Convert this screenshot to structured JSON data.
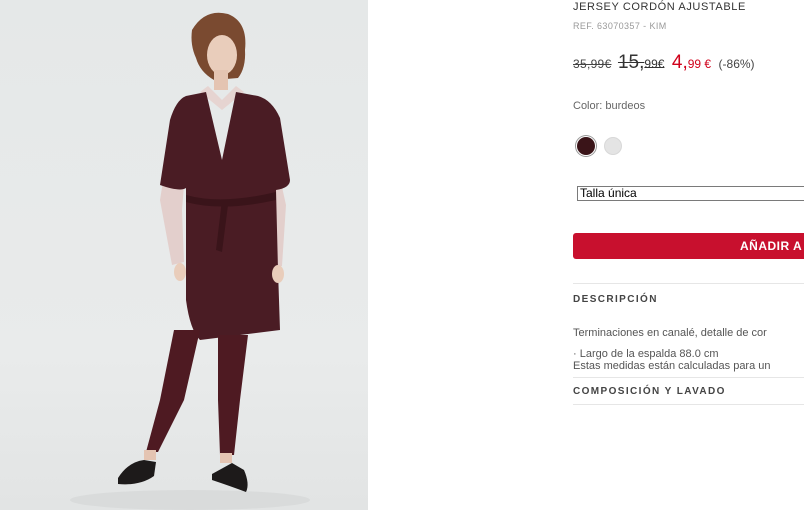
{
  "product": {
    "title": "JERSEY CORDÓN AJUSTABLE",
    "ref": "REF. 63070357 - KIM",
    "price_original": "35,99€",
    "price_previous_main": "15,",
    "price_previous_cents": "99€",
    "price_sale_main": "4,",
    "price_sale_cents": "99 €",
    "discount": "(-86%)",
    "color_label": "Color: burdeos",
    "colors": [
      {
        "name": "burdeos",
        "hex": "#3a1418",
        "selected": true
      },
      {
        "name": "blanco",
        "hex": "#e4e4e4",
        "selected": false
      }
    ],
    "size_selected": "Talla única",
    "add_button_label": "AÑADIR A",
    "description_heading": "DESCRIPCIÓN",
    "description_text": "Terminaciones en canalé, detalle de cor",
    "measure_line1": "· Largo de la espalda 88.0 cm",
    "measure_line2": "Estas medidas están calculadas para un",
    "composition_heading": "COMPOSICIÓN Y LAVADO"
  },
  "colors": {
    "sale_red": "#d0021b",
    "button_red": "#c8102e"
  }
}
